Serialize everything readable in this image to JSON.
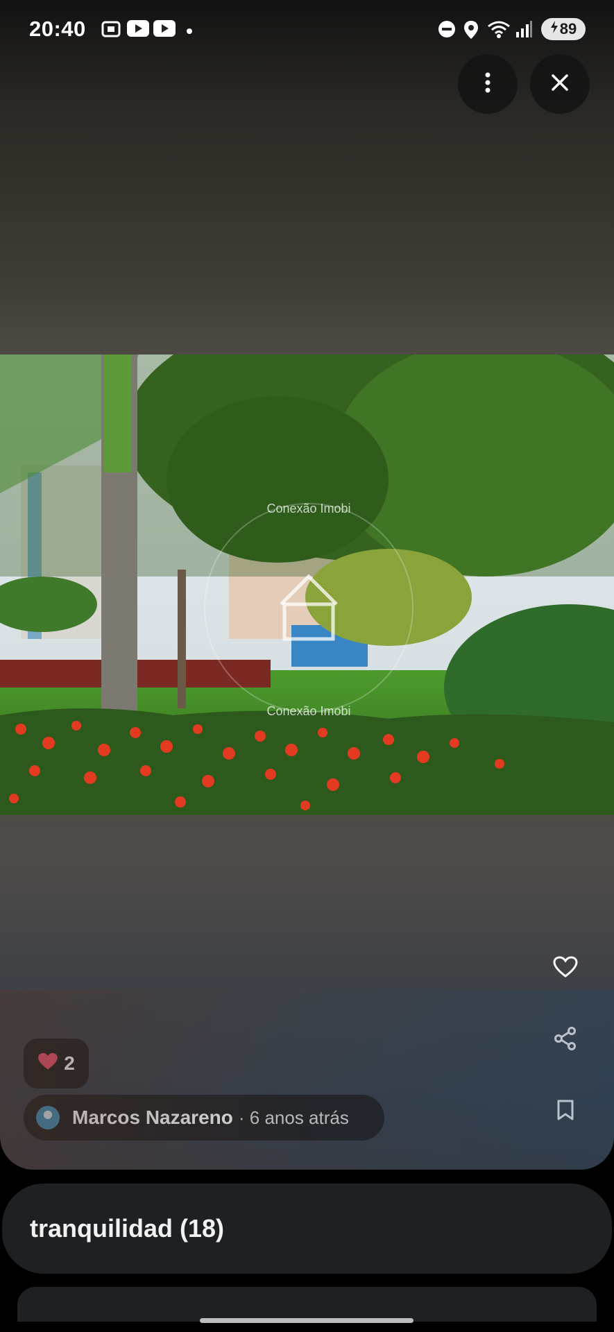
{
  "status_bar": {
    "time": "20:40",
    "battery": "89",
    "icons": [
      "screenshot-icon",
      "youtube-icon",
      "youtube-icon",
      "dot-icon",
      "dnd-icon",
      "location-icon",
      "wifi-icon",
      "signal-icon",
      "charging-icon"
    ]
  },
  "top_actions": {
    "more": "more-options-icon",
    "close": "close-icon"
  },
  "photo": {
    "watermark": "Conexão Imobi"
  },
  "side_actions": [
    "heart-outline-icon",
    "share-icon",
    "bookmark-icon"
  ],
  "likes": {
    "count": "2",
    "color": "#f0506e"
  },
  "author": {
    "name": "Marcos Nazareno",
    "time": "· 6 anos atrás"
  },
  "chip": {
    "label": "tranquilidad (18)"
  },
  "colors": {
    "chip_bg": "#1e2124",
    "button_bg": "#141414"
  }
}
